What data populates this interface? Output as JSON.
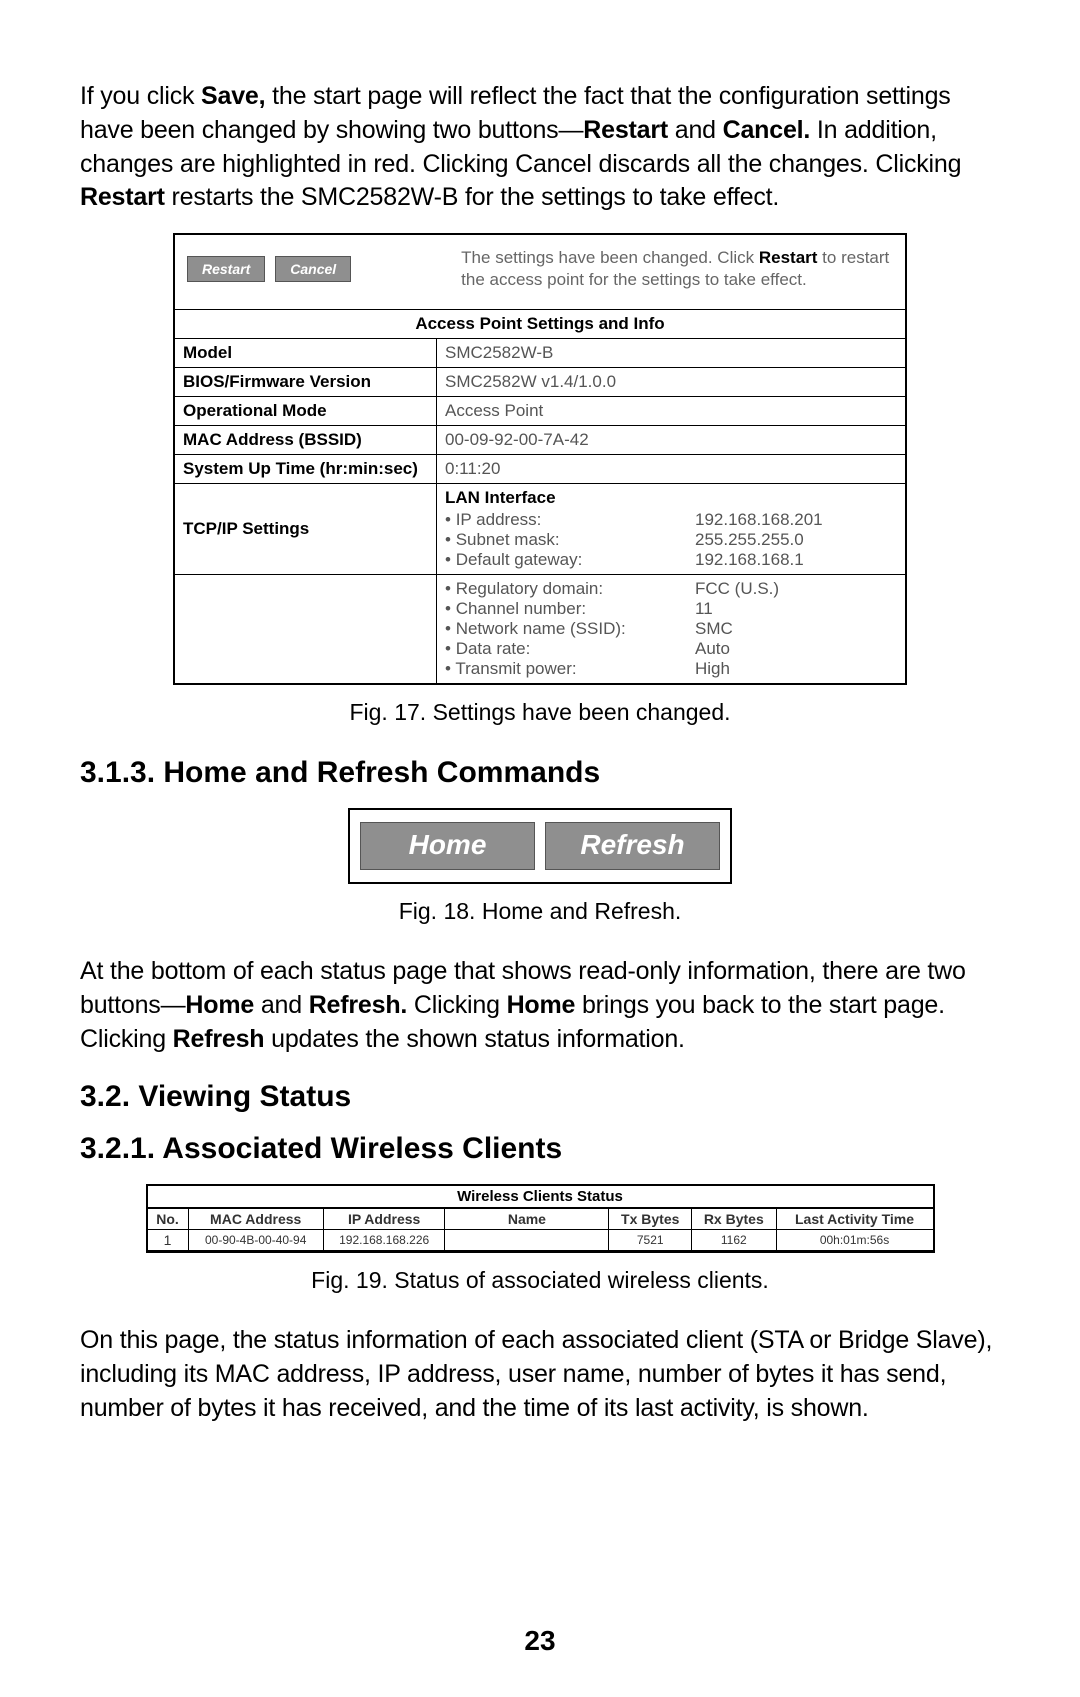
{
  "intro": {
    "pre_save": "If you click ",
    "save": "Save,",
    "after_save": " the start page will reflect the fact that the configuration settings have been changed by showing two buttons—",
    "restart": "Restart",
    "and": " and ",
    "cancel": "Cancel.",
    "after_cancel": " In addition, changes are highlighted in red. Clicking Cancel discards all the changes. Clicking ",
    "restart2": "Restart",
    "tail": " restarts the SMC2582W-B for the settings to take effect."
  },
  "fig17": {
    "buttons": {
      "restart": "Restart",
      "cancel": "Cancel"
    },
    "notice_pre": "The settings have been changed. Click ",
    "notice_b": "Restart",
    "notice_post": " to restart the access point for the settings to take effect.",
    "header": "Access Point Settings and Info",
    "rows": {
      "model_k": "Model",
      "model_v": "SMC2582W-B",
      "fw_k": "BIOS/Firmware Version",
      "fw_v": "SMC2582W v1.4/1.0.0",
      "mode_k": "Operational Mode",
      "mode_v": "Access Point",
      "mac_k": "MAC Address (BSSID)",
      "mac_v": "00-09-92-00-7A-42",
      "uptime_k": "System Up Time (hr:min:sec)",
      "uptime_v": "0:11:20"
    },
    "tcpip_k": "TCP/IP Settings",
    "tcpip": {
      "heading": "LAN Interface",
      "ip_k": "IP address:",
      "ip_v": "192.168.168.201",
      "mask_k": "Subnet mask:",
      "mask_v": "255.255.255.0",
      "gw_k": "Default gateway:",
      "gw_v": "192.168.168.1"
    },
    "wlan": {
      "reg_k": "Regulatory domain:",
      "reg_v": "FCC (U.S.)",
      "ch_k": "Channel number:",
      "ch_v": "11",
      "ssid_k": "Network name (SSID):",
      "ssid_v": "SMC",
      "rate_k": "Data rate:",
      "rate_v": "Auto",
      "tx_k": "Transmit power:",
      "tx_v": "High"
    },
    "caption": "Fig. 17. Settings have been changed."
  },
  "sec313": "3.1.3. Home and Refresh Commands",
  "fig18": {
    "home": "Home",
    "refresh": "Refresh",
    "caption": "Fig. 18. Home and Refresh."
  },
  "p18_pre": "At the bottom of each status page that shows read-only information, there are two buttons—",
  "p18_home": "Home",
  "p18_and": " and ",
  "p18_refresh": "Refresh.",
  "p18_mid": " Clicking ",
  "p18_home2": "Home",
  "p18_mid2": " brings you back to the start page. Clicking ",
  "p18_refresh2": "Refresh",
  "p18_tail": " updates the shown status information.",
  "sec32": "3.2. Viewing Status",
  "sec321": "3.2.1. Associated Wireless Clients",
  "fig19": {
    "title": "Wireless Clients Status",
    "cols": [
      "No.",
      "MAC Address",
      "IP Address",
      "Name",
      "Tx Bytes",
      "Rx Bytes",
      "Last Activity Time"
    ],
    "row": [
      "1",
      "00-90-4B-00-40-94",
      "192.168.168.226",
      "",
      "7521",
      "1162",
      "00h:01m:56s"
    ],
    "caption": "Fig. 19. Status of associated wireless clients."
  },
  "closing": "On this page, the status information of each associated client (STA or Bridge Slave), including its MAC address, IP address, user name, number of bytes it has send, number of bytes it has received, and the time of its last activity, is shown.",
  "page_number": "23"
}
